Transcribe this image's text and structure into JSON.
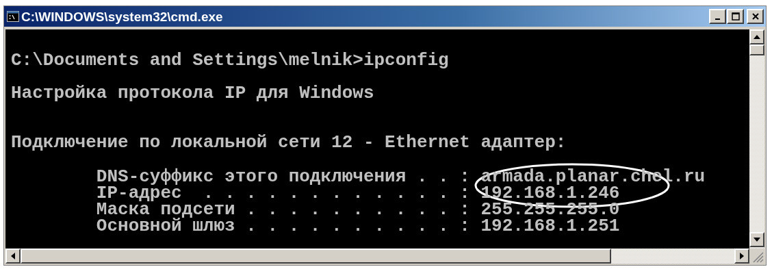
{
  "window": {
    "title": "C:\\WINDOWS\\system32\\cmd.exe",
    "controls": [
      {
        "kind": "minimize"
      },
      {
        "kind": "maximize"
      },
      {
        "kind": "close"
      }
    ]
  },
  "console": {
    "prompt": "C:\\Documents and Settings\\melnik>ipconfig",
    "heading": "Настройка протокола IP для Windows",
    "adapter": "Подключение по локальной сети 12 - Ethernet адаптер:",
    "settings": [
      "        DNS-суффикс этого подключения . . : armada.planar.chel.ru",
      "        IP-адрес  . . . . . . . . . . . . : 192.168.1.246",
      "        Маска подсети . . . . . . . . . . : 255.255.255.0",
      "        Основной шлюз . . . . . . . . . . : 192.168.1.251"
    ]
  }
}
